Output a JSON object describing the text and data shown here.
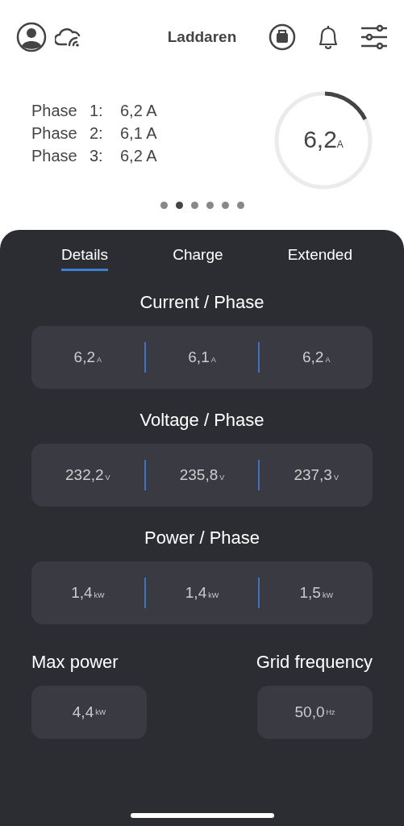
{
  "header": {
    "title": "Laddaren"
  },
  "phases": [
    {
      "label": "Phase",
      "number": "1:",
      "value": "6,2 A"
    },
    {
      "label": "Phase",
      "number": "2:",
      "value": "6,1 A"
    },
    {
      "label": "Phase",
      "number": "3:",
      "value": "6,2 A"
    }
  ],
  "gauge": {
    "value": "6,2",
    "unit": "A"
  },
  "pager": [
    {
      "selected": false
    },
    {
      "selected": true
    },
    {
      "selected": false
    },
    {
      "selected": false
    },
    {
      "selected": false
    },
    {
      "selected": false
    }
  ],
  "tabs": [
    {
      "label": "Details",
      "selected": true
    },
    {
      "label": "Charge",
      "selected": false
    },
    {
      "label": "Extended",
      "selected": false
    }
  ],
  "groups": [
    {
      "title": "Current / Phase",
      "cells": [
        {
          "value": "6,2",
          "unit": "A"
        },
        {
          "value": "6,1",
          "unit": "A"
        },
        {
          "value": "6,2",
          "unit": "A"
        }
      ]
    },
    {
      "title": "Voltage / Phase",
      "cells": [
        {
          "value": "232,2",
          "unit": "V"
        },
        {
          "value": "235,8",
          "unit": "V"
        },
        {
          "value": "237,3",
          "unit": "V"
        }
      ]
    },
    {
      "title": "Power / Phase",
      "cells": [
        {
          "value": "1,4",
          "unit": "kW"
        },
        {
          "value": "1,4",
          "unit": "kW"
        },
        {
          "value": "1,5",
          "unit": "kW"
        }
      ]
    }
  ],
  "singles": [
    {
      "title": "Max power",
      "value": "4,4",
      "unit": "kW"
    },
    {
      "title": "Grid frequency",
      "value": "50,0",
      "unit": "Hz"
    }
  ]
}
